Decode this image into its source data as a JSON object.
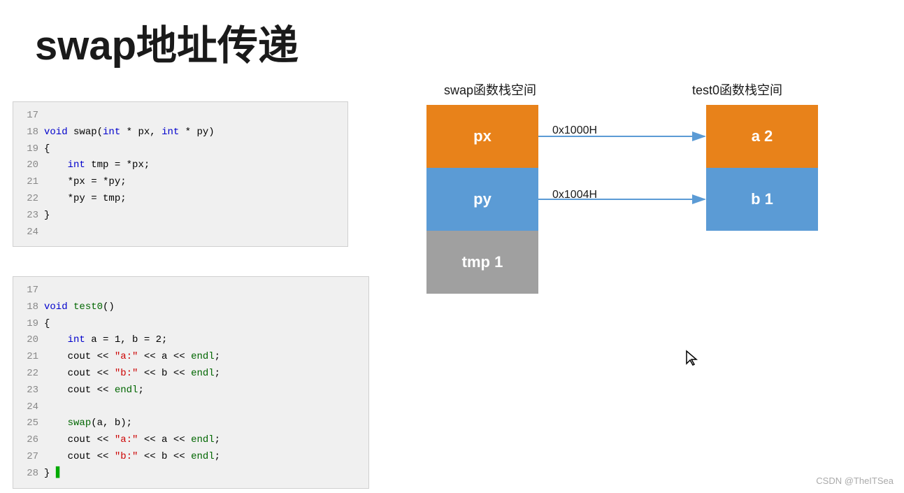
{
  "title": "swap地址传递",
  "code_top": {
    "lines": [
      {
        "num": "17",
        "content": "",
        "raw": true
      },
      {
        "num": "18",
        "content": "void swap(int * px, int * py)",
        "raw": true
      },
      {
        "num": "19",
        "content": "{",
        "raw": true
      },
      {
        "num": "20",
        "content": "    int tmp = *px;",
        "raw": true
      },
      {
        "num": "21",
        "content": "    *px = *py;",
        "raw": true
      },
      {
        "num": "22",
        "content": "    *py = tmp;",
        "raw": true
      },
      {
        "num": "23",
        "content": "}",
        "raw": true
      },
      {
        "num": "24",
        "content": "",
        "raw": true
      }
    ]
  },
  "code_bottom": {
    "lines": [
      {
        "num": "17",
        "content": "",
        "raw": true
      },
      {
        "num": "18",
        "content": "void test0()",
        "raw": true
      },
      {
        "num": "19",
        "content": "{",
        "raw": true
      },
      {
        "num": "20",
        "content": "    int a = 1, b = 2;",
        "raw": true
      },
      {
        "num": "21",
        "content": "    cout << \"a:\" << a << endl;",
        "raw": true
      },
      {
        "num": "22",
        "content": "    cout << \"b:\" << b << endl;",
        "raw": true
      },
      {
        "num": "23",
        "content": "    cout << endl;",
        "raw": true
      },
      {
        "num": "24",
        "content": "",
        "raw": true
      },
      {
        "num": "25",
        "content": "    swap(a, b);",
        "raw": true
      },
      {
        "num": "26",
        "content": "    cout << \"a:\" << a << endl;",
        "raw": true
      },
      {
        "num": "27",
        "content": "    cout << \"b:\" << b << endl;",
        "raw": true
      },
      {
        "num": "28",
        "content": "}",
        "raw": true
      }
    ]
  },
  "diagram": {
    "swap_stack_label": "swap函数栈空间",
    "test0_stack_label": "test0函数栈空间",
    "box_px": "px",
    "box_py": "py",
    "box_tmp": "tmp 1",
    "box_a": "a 2",
    "box_b": "b 1",
    "arrow_top_label": "0x1000H",
    "arrow_bottom_label": "0x1004H"
  },
  "watermark": "CSDN @TheITSea"
}
